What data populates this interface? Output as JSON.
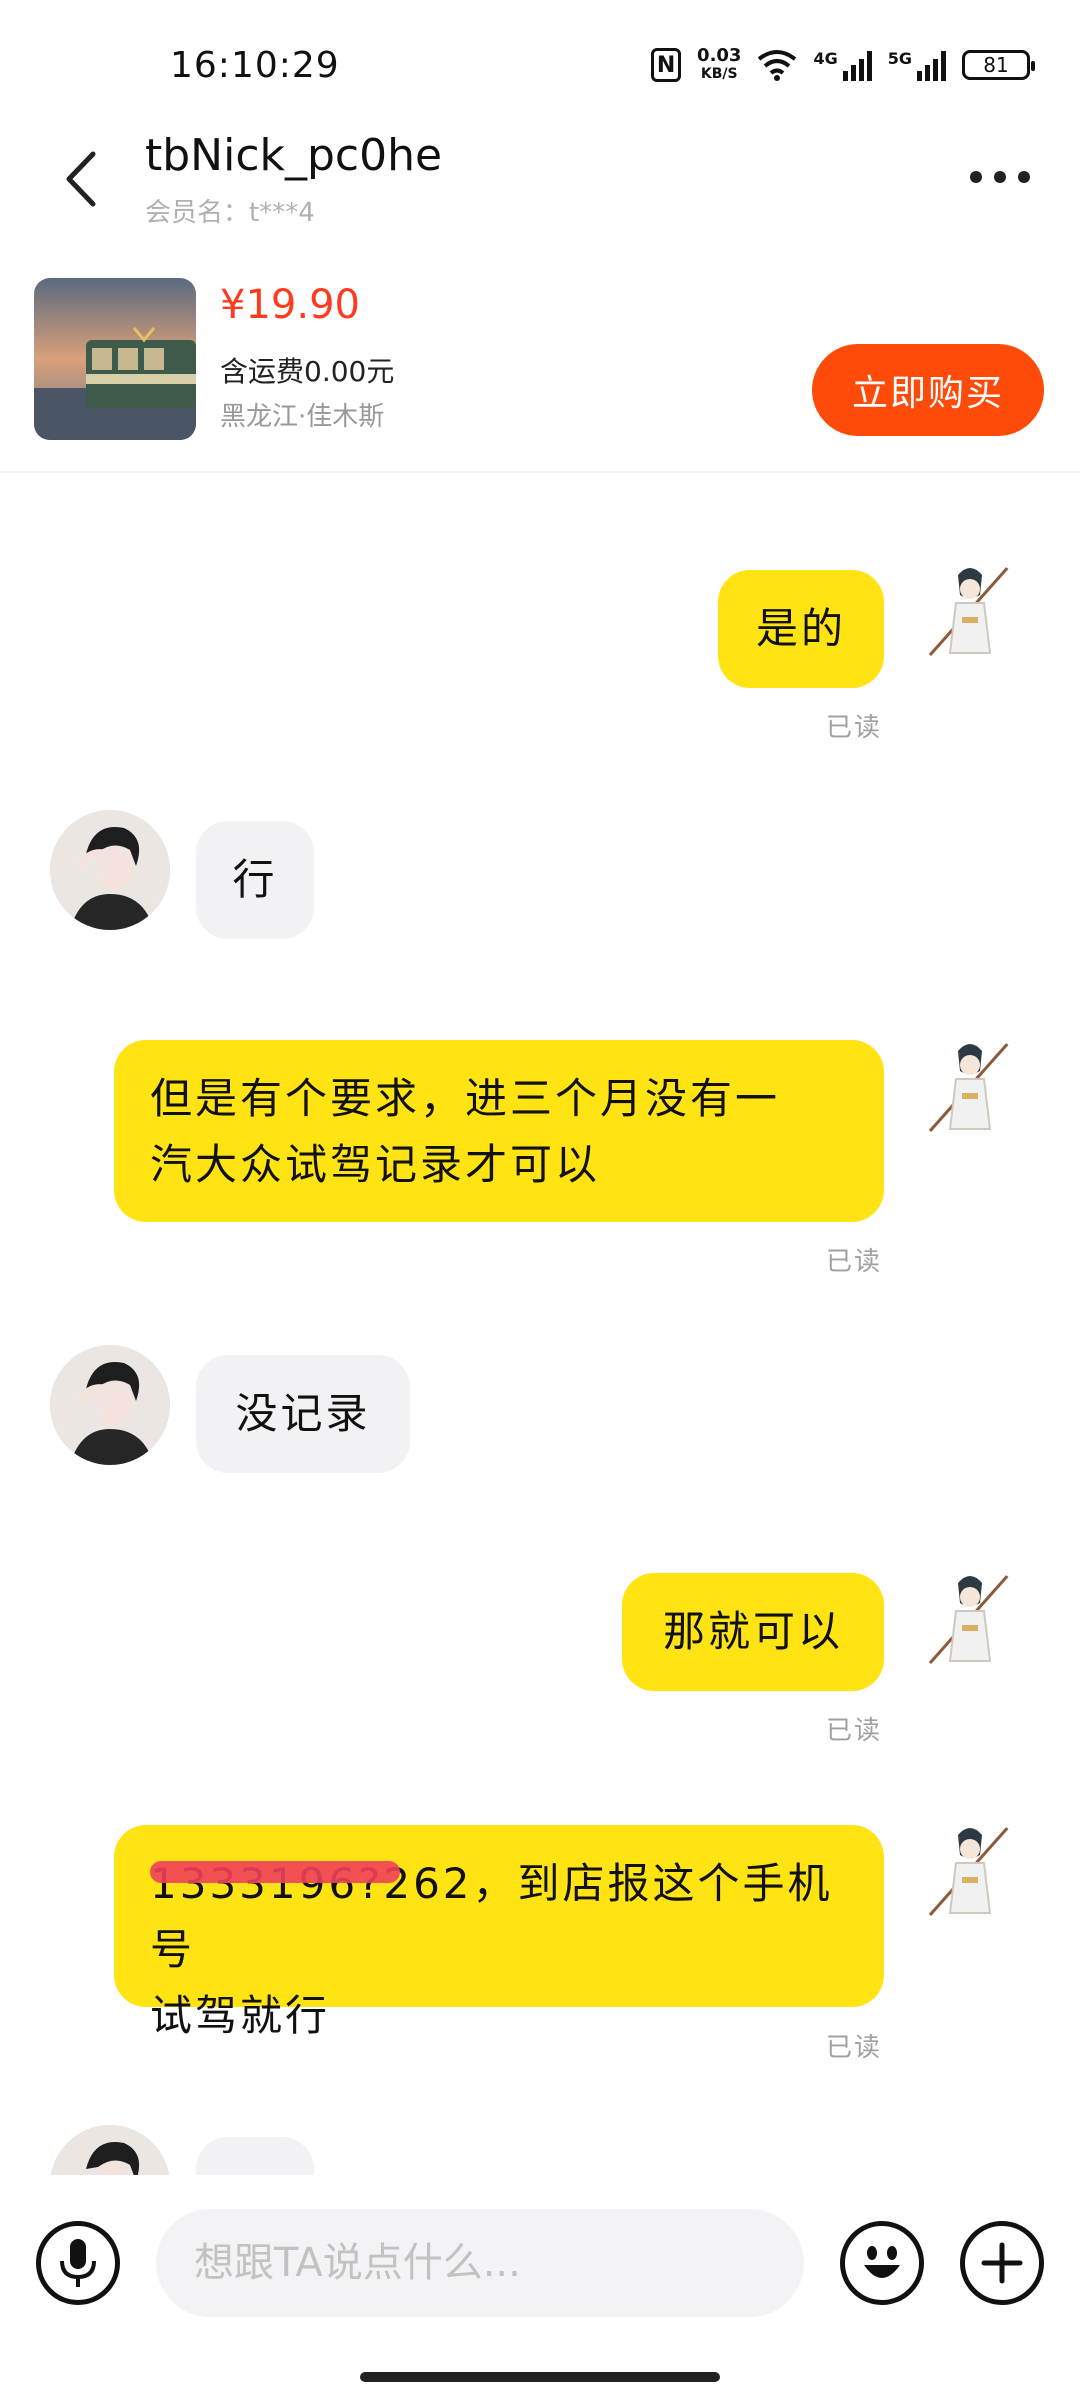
{
  "status_bar": {
    "time": "16:10:29",
    "nfc": "N",
    "net_speed_value": "0.03",
    "net_speed_unit": "KB/S",
    "signal_1_label": "4G",
    "signal_2_label": "5G",
    "battery": "81"
  },
  "header": {
    "nickname": "tbNick_pc0he",
    "member_name": "会员名：t***4"
  },
  "product": {
    "price": "¥19.90",
    "shipping": "含运费0.00元",
    "location": "黑龙江·佳木斯",
    "buy_label": "立即购买"
  },
  "messages": [
    {
      "from": "me",
      "text": "是的",
      "read": "已读"
    },
    {
      "from": "them",
      "text": "行"
    },
    {
      "from": "me",
      "line1": "但是有个要求，进三个月没有一",
      "line2": "汽大众试驾记录才可以",
      "read": "已读"
    },
    {
      "from": "them",
      "text": "没记录"
    },
    {
      "from": "me",
      "text": "那就可以",
      "read": "已读"
    },
    {
      "from": "me",
      "line1": "1333196?262，到店报这个手机号",
      "line2": "试驾就行",
      "read": "已读"
    }
  ],
  "input": {
    "placeholder": "想跟TA说点什么..."
  },
  "icons": {
    "back": "chevron-left-icon",
    "more": "more-dots-icon",
    "voice": "microphone-icon",
    "emoji": "emoji-icon",
    "plus": "plus-icon"
  },
  "colors": {
    "my_bubble": "#ffe312",
    "their_bubble": "#f2f2f4",
    "price": "#ff3a1f",
    "buy_button": "#ff4b0a"
  }
}
